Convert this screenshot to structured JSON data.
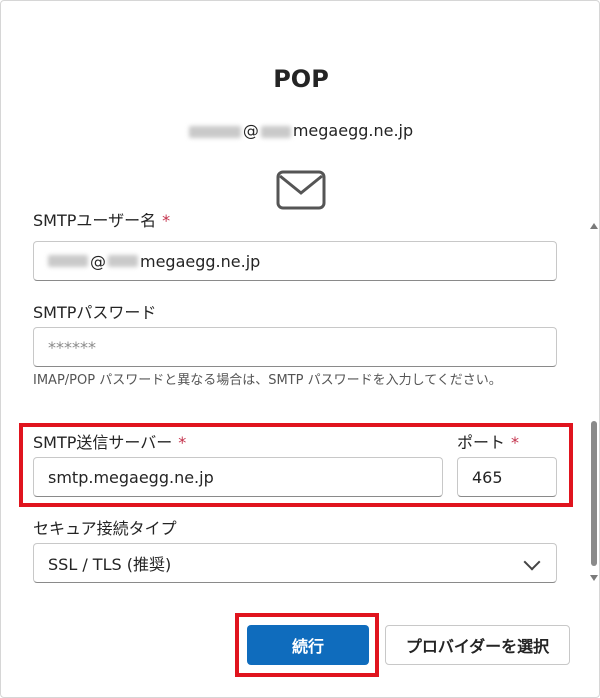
{
  "header": {
    "title": "POP",
    "email_visible": "megaegg.ne.jp",
    "email_at": "@"
  },
  "icons": {
    "mail": "mail-icon",
    "dropdown": "chevron-down-icon"
  },
  "fields": {
    "smtp_user": {
      "label": "SMTPユーザー名",
      "required_mark": "*",
      "at": "@",
      "value_visible": "megaegg.ne.jp"
    },
    "smtp_password": {
      "label": "SMTPパスワード",
      "value": "******"
    },
    "password_hint": "IMAP/POP パスワードと異なる場合は、SMTP パスワードを入力してください。",
    "smtp_server": {
      "label": "SMTP送信サーバー",
      "required_mark": "*",
      "value": "smtp.megaegg.ne.jp"
    },
    "port": {
      "label": "ポート",
      "required_mark": "*",
      "value": "465"
    },
    "security": {
      "label": "セキュア接続タイプ",
      "value": "SSL / TLS (推奨)"
    }
  },
  "buttons": {
    "continue": "続行",
    "select_provider": "プロバイダーを選択"
  },
  "colors": {
    "accent": "#0f6cbd",
    "highlight": "#e0141e",
    "required": "#c4314b"
  }
}
